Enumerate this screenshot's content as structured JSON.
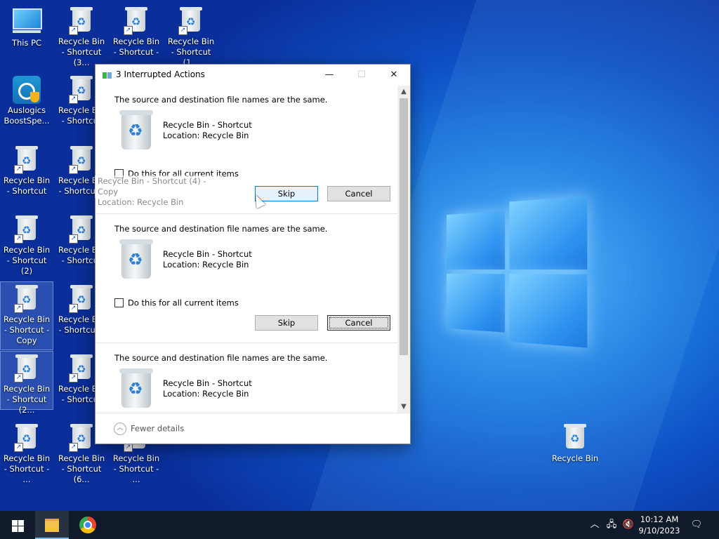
{
  "desktop": {
    "icons": [
      {
        "label": "This PC"
      },
      {
        "label": "Recycle Bin - Shortcut (3..."
      },
      {
        "label": "Recycle Bin - Shortcut - ..."
      },
      {
        "label": "Recycle Bin - Shortcut (1..."
      },
      {
        "label": "Auslogics BoostSpe..."
      },
      {
        "label": "Recycle Bin - Shortcut"
      },
      {
        "label": "Recycle Bin - Shortcut"
      },
      {
        "label": "Recycle Bin - Shortcut ("
      },
      {
        "label": "Recycle Bin - Shortcut (2)"
      },
      {
        "label": "Recycle Bin - Shortcut"
      },
      {
        "label": "Recycle Bin - Shortcut - Copy"
      },
      {
        "label": "Recycle Bin - Shortcut ("
      },
      {
        "label": "Recycle Bin - Shortcut (2..."
      },
      {
        "label": "Recycle Bin - Shortcut"
      },
      {
        "label": "Recycle Bin - Shortcut - ..."
      },
      {
        "label": "Recycle Bin - Shortcut (6..."
      },
      {
        "label": "Recycle Bin - Shortcut - ..."
      },
      {
        "label": "Recycle Bin"
      }
    ],
    "drag_ghost": {
      "line1": "Recycle Bin - Shortcut (4) - Copy",
      "line2": "Location: Recycle Bin"
    }
  },
  "dialog": {
    "title": "3 Interrupted Actions",
    "minimize_glyph": "—",
    "maximize_glyph": "☐",
    "close_glyph": "✕",
    "items": [
      {
        "message": "The source and destination file names are the same.",
        "name": "Recycle Bin - Shortcut",
        "location": "Location: Recycle Bin",
        "checkbox_label": "Do this for all current items",
        "skip_label": "Skip",
        "cancel_label": "Cancel"
      },
      {
        "message": "The source and destination file names are the same.",
        "name": "Recycle Bin - Shortcut",
        "location": "Location: Recycle Bin",
        "checkbox_label": "Do this for all current items",
        "skip_label": "Skip",
        "cancel_label": "Cancel"
      },
      {
        "message": "The source and destination file names are the same.",
        "name": "Recycle Bin - Shortcut",
        "location": "Location: Recycle Bin"
      }
    ],
    "fewer_details_label": "Fewer details"
  },
  "taskbar": {
    "time": "10:12 AM",
    "date": "9/10/2023"
  },
  "colors": {
    "accent": "#0078d7",
    "taskbar": "#101a2a"
  }
}
